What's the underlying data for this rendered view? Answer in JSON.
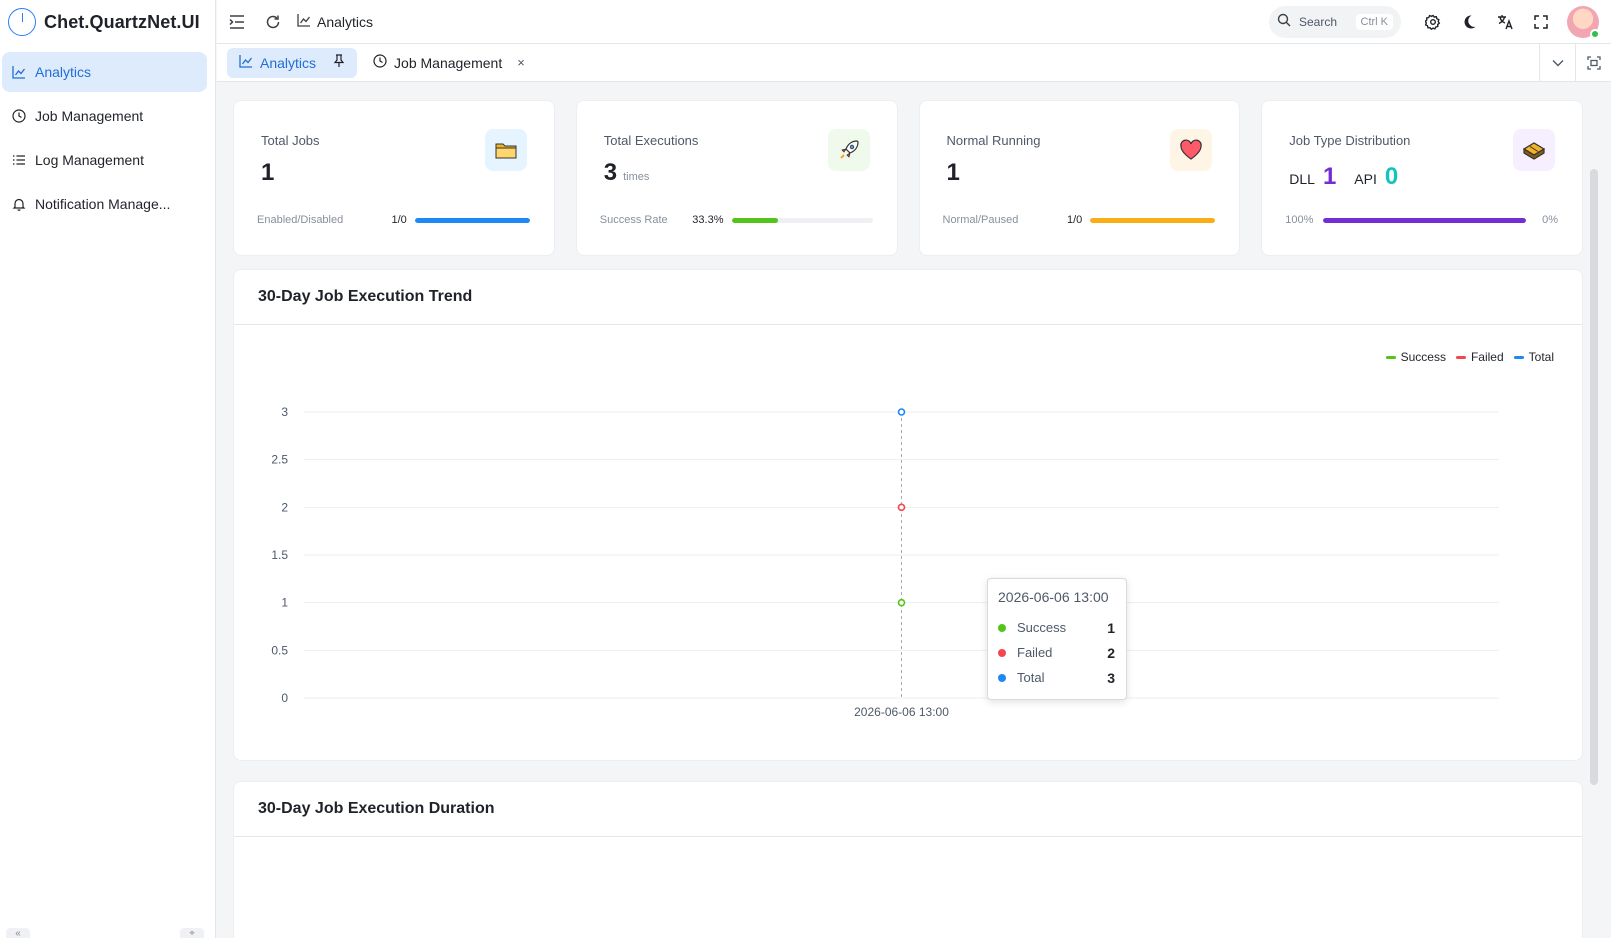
{
  "app": {
    "name": "Chet.QuartzNet.UI"
  },
  "sidebar": {
    "items": [
      {
        "label": "Analytics",
        "icon": "chart-icon",
        "active": true
      },
      {
        "label": "Job Management",
        "icon": "clock-icon"
      },
      {
        "label": "Log Management",
        "icon": "list-icon"
      },
      {
        "label": "Notification Manage...",
        "icon": "bell-icon"
      }
    ]
  },
  "header": {
    "breadcrumb": "Analytics",
    "search_placeholder": "Search",
    "search_shortcut": "Ctrl K"
  },
  "tabs": [
    {
      "label": "Analytics",
      "active": true,
      "pinned": true
    },
    {
      "label": "Job Management",
      "closable": true,
      "close_glyph": "×"
    }
  ],
  "cards": {
    "total_jobs": {
      "title": "Total Jobs",
      "value": "1",
      "foot_label": "Enabled/Disabled",
      "ratio": "1/0",
      "progress": 1.0,
      "color": "#1e88f5"
    },
    "total_executions": {
      "title": "Total Executions",
      "value": "3",
      "unit": "times",
      "foot_label": "Success Rate",
      "ratio": "33.3%",
      "progress": 0.333,
      "color": "#52c41a"
    },
    "normal_running": {
      "title": "Normal Running",
      "value": "1",
      "foot_label": "Normal/Paused",
      "ratio": "1/0",
      "progress": 1.0,
      "color": "#faad14"
    },
    "job_type": {
      "title": "Job Type Distribution",
      "dll_label": "DLL",
      "dll_value": "1",
      "api_label": "API",
      "api_value": "0",
      "left_pct": "100%",
      "right_pct": "0%",
      "progress": 1.0,
      "color": "#722ed1",
      "dll_color": "#722ed1",
      "api_color": "#13c2c2"
    }
  },
  "trend_panel": {
    "title": "30-Day Job Execution Trend"
  },
  "duration_panel": {
    "title": "30-Day Job Execution Duration"
  },
  "chart_data": {
    "type": "line",
    "title": "30-Day Job Execution Trend",
    "x": [
      "2026-06-06 13:00"
    ],
    "series": [
      {
        "name": "Success",
        "values": [
          1
        ],
        "color": "#52c41a"
      },
      {
        "name": "Failed",
        "values": [
          2
        ],
        "color": "#f5454f"
      },
      {
        "name": "Total",
        "values": [
          3
        ],
        "color": "#1e88f5"
      }
    ],
    "y_ticks": [
      "0",
      "0.5",
      "1",
      "1.5",
      "2",
      "2.5",
      "3"
    ],
    "ylim": [
      0,
      3
    ],
    "grid": true,
    "legend": "top-right",
    "tooltip": {
      "title": "2026-06-06 13:00",
      "rows": [
        {
          "name": "Success",
          "value": "1"
        },
        {
          "name": "Failed",
          "value": "2"
        },
        {
          "name": "Total",
          "value": "3"
        }
      ]
    }
  }
}
